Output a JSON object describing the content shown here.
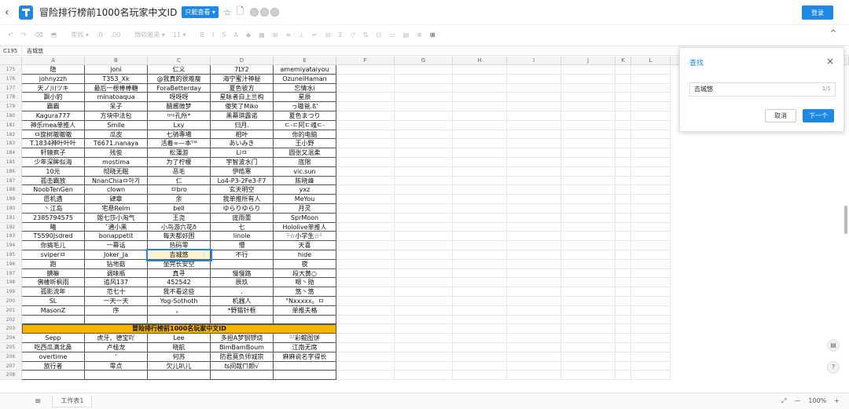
{
  "titlebar": {
    "title": "冒险排行榜前1000名玩家中文ID",
    "badge": "只能查看 ▾",
    "login": "登录"
  },
  "toolbar": {
    "items": [
      "↶",
      "↷",
      "⌫",
      "⬒",
      "常规 ▾",
      ".0",
      ".00",
      "微软雅黑 ▾",
      "11 ▾",
      "B",
      "I",
      "S",
      "A",
      "◆",
      "▦",
      "⊞",
      "≡",
      "⊥",
      "↵",
      "⊟",
      "Σ",
      "▽",
      "⇅",
      "⊡",
      "▭",
      "▤",
      "⊕",
      "⊞"
    ],
    "collapse": "^"
  },
  "formulabar": {
    "cell_ref": "C195",
    "content": "吉城悠"
  },
  "grid": {
    "columns": [
      "A",
      "B",
      "C",
      "D",
      "E",
      "F",
      "G",
      "H",
      "I",
      "J",
      "K",
      "L"
    ],
    "rows": [
      {
        "n": "175",
        "c": [
          "隐",
          "joni",
          "仁义",
          "7LY2",
          "amemiyataiyou"
        ]
      },
      {
        "n": "176",
        "c": [
          "johnyzzh",
          "T353_Xk",
          "@我真的很难瘦",
          "海宁蜜汁神秘",
          "OzuneiHaman"
        ]
      },
      {
        "n": "177",
        "c": [
          "天ノ川ツキ",
          "最后一根棒棒糖",
          "ForaBetterday",
          "夏色彼方",
          "忘情水i"
        ]
      },
      {
        "n": "178",
        "c": [
          "飘小豹",
          "minatoaqua",
          "呀呀呀",
          "星咏者白上兰构",
          "星辰"
        ]
      },
      {
        "n": "179",
        "c": [
          "霸霸",
          "呆子",
          "醋酱微梦",
          "傻笑了Miko",
          "っ嗷爸.ß'"
        ]
      },
      {
        "n": "180",
        "c": [
          "Kagura777",
          "方块中法包",
          "ᶦᶳᶦᶳ孔所*",
          "黑幕琪露诺",
          "夏色まつり"
        ]
      },
      {
        "n": "181",
        "c": [
          "神乐mea单推人",
          "Smile",
          "Lxy",
          "归月.",
          "ㄷ-ㄷ阿ㄷ魂ㄷ-"
        ]
      },
      {
        "n": "182",
        "c": [
          "ㅁ旋树嗷嗷嗷",
          "瓜皮",
          "七骑專場",
          "相叶",
          "你的电脑"
        ]
      },
      {
        "n": "183",
        "c": [
          "T.1834神叶叶叶",
          "T6671.nanaya",
          "活着∞—本ᵀᴹ",
          "あいみき",
          "王小野"
        ]
      },
      {
        "n": "184",
        "c": [
          "轩辕疯子",
          "残俊",
          "松蒲游",
          "Liㅁ",
          "圆张又温柔"
        ]
      },
      {
        "n": "185",
        "c": [
          "少年深眸似海",
          "mostima",
          "为了柠檬",
          "宇智波水门",
          "底限"
        ]
      },
      {
        "n": "186",
        "c": [
          "10元",
          "彻晓无眠",
          "恶毛",
          "伊皓寒",
          "vic.sun"
        ]
      },
      {
        "n": "187",
        "c": [
          "孤击霸放",
          "NnanChiaㅁ아기",
          "仁",
          "Lo4-P3-2Fe3-F7",
          "陈晓峰"
        ]
      },
      {
        "n": "188",
        "c": [
          "NoobTenGen",
          "clown",
          "ㅁbro",
          "玄天明空",
          "yxz"
        ]
      },
      {
        "n": "189",
        "c": [
          "愿机遇",
          "肆章",
          "余",
          "我单推所有人",
          "MeYou"
        ]
      },
      {
        "n": "190",
        "c": [
          "丶江岛",
          "宅悬Relm",
          "bell",
          "ゆらりゆらり",
          "月灵"
        ]
      },
      {
        "n": "191",
        "c": [
          "2385794575",
          "姬七莎小淘气",
          "王尧",
          "庞雨蕾",
          "SprMoon"
        ]
      },
      {
        "n": "192",
        "c": [
          "曦",
          "ˇ通小黑",
          "小鸟游六花ð",
          "七",
          "Hololive单推人"
        ]
      },
      {
        "n": "193",
        "c": [
          "T5590Jsdred",
          "bonappetit",
          "每天都好困",
          "linole",
          "ᵕ̈☆小学生☆ᵕ̈"
        ]
      },
      {
        "n": "194",
        "c": [
          "你搞毛儿",
          "一幕话",
          "热码零",
          "懵",
          "天喜"
        ]
      },
      {
        "n": "195",
        "c": [
          "sviperㅁ",
          "Joker_Ja",
          "吉城悠",
          "不行",
          "hide"
        ]
      },
      {
        "n": "196",
        "c": [
          "跑",
          "钻地菇",
          "坐完长安空",
          "",
          "夜"
        ]
      },
      {
        "n": "197",
        "c": [
          "腆嘛",
          "调味瓶",
          "真寻",
          "慢慢路",
          "段大黄○"
        ]
      },
      {
        "n": "198",
        "c": [
          "佛楼听枫雨",
          "追风137",
          "452542",
          "辰玖",
          "嗯丶勋"
        ]
      },
      {
        "n": "199",
        "c": [
          "孤影流年",
          "范七十",
          "我不看这些",
          ".",
          "悠丶悠"
        ]
      },
      {
        "n": "200",
        "c": [
          "SL",
          "一天一天",
          "Yog-Sothoth",
          "机器人",
          "°Nxxxxx。ㅁ"
        ]
      },
      {
        "n": "201",
        "c": [
          "MasonZ",
          "序",
          "。",
          "*野猫针框",
          "单推夫格"
        ]
      },
      {
        "n": "202",
        "c": [
          "",
          "",
          "",
          "",
          ""
        ]
      },
      {
        "n": "203",
        "c": [
          "冒险排行榜前1000名玩家中文ID"
        ]
      },
      {
        "n": "204",
        "c": [
          "Sepp",
          "虎牙、德宝吖",
          "Lee",
          "多担A梦钢锣烧",
          "ᵕ̈ᵕ̈彩鲲图饼"
        ]
      },
      {
        "n": "205",
        "c": [
          "吃西瓜满北鼻",
          "卢桂龙",
          "晓航",
          "BimBamBoum",
          "江南无席"
        ]
      },
      {
        "n": "206",
        "c": [
          "overtime",
          "'",
          "何苏",
          "防君莫负师城宗",
          "麻麻说名字得长"
        ]
      },
      {
        "n": "207",
        "c": [
          "旅行者",
          "零点",
          "欠儿叭儿",
          "ʦ间哉ㄇ颜√",
          ""
        ]
      },
      {
        "n": "208",
        "c": [
          "",
          "",
          "",
          "",
          ""
        ]
      }
    ],
    "selected": "C195"
  },
  "find_panel": {
    "title": "查找",
    "close": "×",
    "query": "吉城悠",
    "count": "1/1",
    "cancel": "取消",
    "next": "下一个"
  },
  "side": {
    "icon1": "▤",
    "icon2": "?"
  },
  "bottombar": {
    "menu": "≡",
    "sheet": "工作表1",
    "zoom_out": "—",
    "zoom": "100%",
    "zoom_in": "+",
    "fit": "⤢"
  },
  "colors": {
    "accent": "#1e88e5",
    "header_row": "#f4b400",
    "selected_cell": "#fff3cd"
  }
}
